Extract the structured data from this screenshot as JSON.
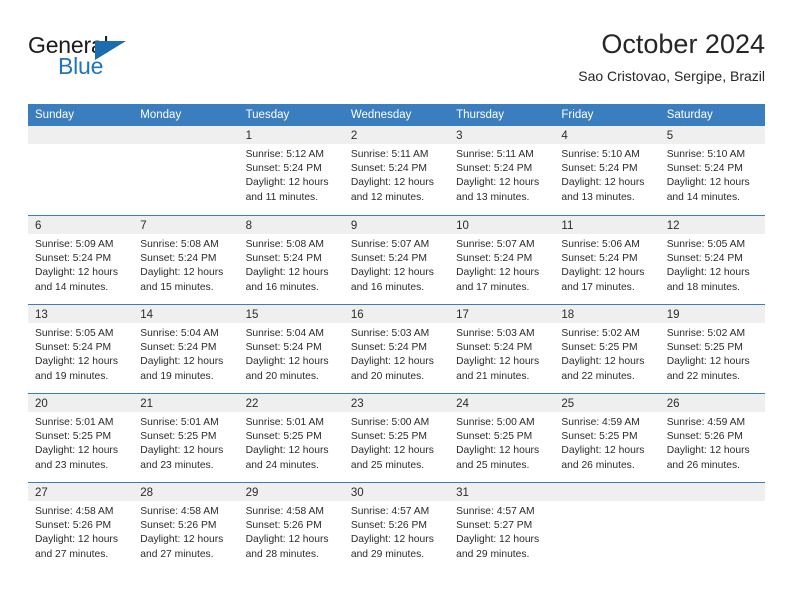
{
  "brand": {
    "name_top": "General",
    "name_bottom": "Blue",
    "triangle_icon": "triangle-icon",
    "color_dark": "#1b1b1b",
    "color_blue": "#2075bc"
  },
  "header": {
    "title": "October 2024",
    "subtitle": "Sao Cristovao, Sergipe, Brazil"
  },
  "theme": {
    "header_row_bg": "#3a7ebf",
    "day_band_bg": "#efefef",
    "separator": "#3a7ebf",
    "text": "#2b2b2b"
  },
  "weekdays": [
    "Sunday",
    "Monday",
    "Tuesday",
    "Wednesday",
    "Thursday",
    "Friday",
    "Saturday"
  ],
  "weeks": [
    [
      {
        "day": "",
        "sunrise": "",
        "sunset": "",
        "daylight1": "",
        "daylight2": ""
      },
      {
        "day": "",
        "sunrise": "",
        "sunset": "",
        "daylight1": "",
        "daylight2": ""
      },
      {
        "day": "1",
        "sunrise": "Sunrise: 5:12 AM",
        "sunset": "Sunset: 5:24 PM",
        "daylight1": "Daylight: 12 hours",
        "daylight2": "and 11 minutes."
      },
      {
        "day": "2",
        "sunrise": "Sunrise: 5:11 AM",
        "sunset": "Sunset: 5:24 PM",
        "daylight1": "Daylight: 12 hours",
        "daylight2": "and 12 minutes."
      },
      {
        "day": "3",
        "sunrise": "Sunrise: 5:11 AM",
        "sunset": "Sunset: 5:24 PM",
        "daylight1": "Daylight: 12 hours",
        "daylight2": "and 13 minutes."
      },
      {
        "day": "4",
        "sunrise": "Sunrise: 5:10 AM",
        "sunset": "Sunset: 5:24 PM",
        "daylight1": "Daylight: 12 hours",
        "daylight2": "and 13 minutes."
      },
      {
        "day": "5",
        "sunrise": "Sunrise: 5:10 AM",
        "sunset": "Sunset: 5:24 PM",
        "daylight1": "Daylight: 12 hours",
        "daylight2": "and 14 minutes."
      }
    ],
    [
      {
        "day": "6",
        "sunrise": "Sunrise: 5:09 AM",
        "sunset": "Sunset: 5:24 PM",
        "daylight1": "Daylight: 12 hours",
        "daylight2": "and 14 minutes."
      },
      {
        "day": "7",
        "sunrise": "Sunrise: 5:08 AM",
        "sunset": "Sunset: 5:24 PM",
        "daylight1": "Daylight: 12 hours",
        "daylight2": "and 15 minutes."
      },
      {
        "day": "8",
        "sunrise": "Sunrise: 5:08 AM",
        "sunset": "Sunset: 5:24 PM",
        "daylight1": "Daylight: 12 hours",
        "daylight2": "and 16 minutes."
      },
      {
        "day": "9",
        "sunrise": "Sunrise: 5:07 AM",
        "sunset": "Sunset: 5:24 PM",
        "daylight1": "Daylight: 12 hours",
        "daylight2": "and 16 minutes."
      },
      {
        "day": "10",
        "sunrise": "Sunrise: 5:07 AM",
        "sunset": "Sunset: 5:24 PM",
        "daylight1": "Daylight: 12 hours",
        "daylight2": "and 17 minutes."
      },
      {
        "day": "11",
        "sunrise": "Sunrise: 5:06 AM",
        "sunset": "Sunset: 5:24 PM",
        "daylight1": "Daylight: 12 hours",
        "daylight2": "and 17 minutes."
      },
      {
        "day": "12",
        "sunrise": "Sunrise: 5:05 AM",
        "sunset": "Sunset: 5:24 PM",
        "daylight1": "Daylight: 12 hours",
        "daylight2": "and 18 minutes."
      }
    ],
    [
      {
        "day": "13",
        "sunrise": "Sunrise: 5:05 AM",
        "sunset": "Sunset: 5:24 PM",
        "daylight1": "Daylight: 12 hours",
        "daylight2": "and 19 minutes."
      },
      {
        "day": "14",
        "sunrise": "Sunrise: 5:04 AM",
        "sunset": "Sunset: 5:24 PM",
        "daylight1": "Daylight: 12 hours",
        "daylight2": "and 19 minutes."
      },
      {
        "day": "15",
        "sunrise": "Sunrise: 5:04 AM",
        "sunset": "Sunset: 5:24 PM",
        "daylight1": "Daylight: 12 hours",
        "daylight2": "and 20 minutes."
      },
      {
        "day": "16",
        "sunrise": "Sunrise: 5:03 AM",
        "sunset": "Sunset: 5:24 PM",
        "daylight1": "Daylight: 12 hours",
        "daylight2": "and 20 minutes."
      },
      {
        "day": "17",
        "sunrise": "Sunrise: 5:03 AM",
        "sunset": "Sunset: 5:24 PM",
        "daylight1": "Daylight: 12 hours",
        "daylight2": "and 21 minutes."
      },
      {
        "day": "18",
        "sunrise": "Sunrise: 5:02 AM",
        "sunset": "Sunset: 5:25 PM",
        "daylight1": "Daylight: 12 hours",
        "daylight2": "and 22 minutes."
      },
      {
        "day": "19",
        "sunrise": "Sunrise: 5:02 AM",
        "sunset": "Sunset: 5:25 PM",
        "daylight1": "Daylight: 12 hours",
        "daylight2": "and 22 minutes."
      }
    ],
    [
      {
        "day": "20",
        "sunrise": "Sunrise: 5:01 AM",
        "sunset": "Sunset: 5:25 PM",
        "daylight1": "Daylight: 12 hours",
        "daylight2": "and 23 minutes."
      },
      {
        "day": "21",
        "sunrise": "Sunrise: 5:01 AM",
        "sunset": "Sunset: 5:25 PM",
        "daylight1": "Daylight: 12 hours",
        "daylight2": "and 23 minutes."
      },
      {
        "day": "22",
        "sunrise": "Sunrise: 5:01 AM",
        "sunset": "Sunset: 5:25 PM",
        "daylight1": "Daylight: 12 hours",
        "daylight2": "and 24 minutes."
      },
      {
        "day": "23",
        "sunrise": "Sunrise: 5:00 AM",
        "sunset": "Sunset: 5:25 PM",
        "daylight1": "Daylight: 12 hours",
        "daylight2": "and 25 minutes."
      },
      {
        "day": "24",
        "sunrise": "Sunrise: 5:00 AM",
        "sunset": "Sunset: 5:25 PM",
        "daylight1": "Daylight: 12 hours",
        "daylight2": "and 25 minutes."
      },
      {
        "day": "25",
        "sunrise": "Sunrise: 4:59 AM",
        "sunset": "Sunset: 5:25 PM",
        "daylight1": "Daylight: 12 hours",
        "daylight2": "and 26 minutes."
      },
      {
        "day": "26",
        "sunrise": "Sunrise: 4:59 AM",
        "sunset": "Sunset: 5:26 PM",
        "daylight1": "Daylight: 12 hours",
        "daylight2": "and 26 minutes."
      }
    ],
    [
      {
        "day": "27",
        "sunrise": "Sunrise: 4:58 AM",
        "sunset": "Sunset: 5:26 PM",
        "daylight1": "Daylight: 12 hours",
        "daylight2": "and 27 minutes."
      },
      {
        "day": "28",
        "sunrise": "Sunrise: 4:58 AM",
        "sunset": "Sunset: 5:26 PM",
        "daylight1": "Daylight: 12 hours",
        "daylight2": "and 27 minutes."
      },
      {
        "day": "29",
        "sunrise": "Sunrise: 4:58 AM",
        "sunset": "Sunset: 5:26 PM",
        "daylight1": "Daylight: 12 hours",
        "daylight2": "and 28 minutes."
      },
      {
        "day": "30",
        "sunrise": "Sunrise: 4:57 AM",
        "sunset": "Sunset: 5:26 PM",
        "daylight1": "Daylight: 12 hours",
        "daylight2": "and 29 minutes."
      },
      {
        "day": "31",
        "sunrise": "Sunrise: 4:57 AM",
        "sunset": "Sunset: 5:27 PM",
        "daylight1": "Daylight: 12 hours",
        "daylight2": "and 29 minutes."
      },
      {
        "day": "",
        "sunrise": "",
        "sunset": "",
        "daylight1": "",
        "daylight2": ""
      },
      {
        "day": "",
        "sunrise": "",
        "sunset": "",
        "daylight1": "",
        "daylight2": ""
      }
    ]
  ]
}
